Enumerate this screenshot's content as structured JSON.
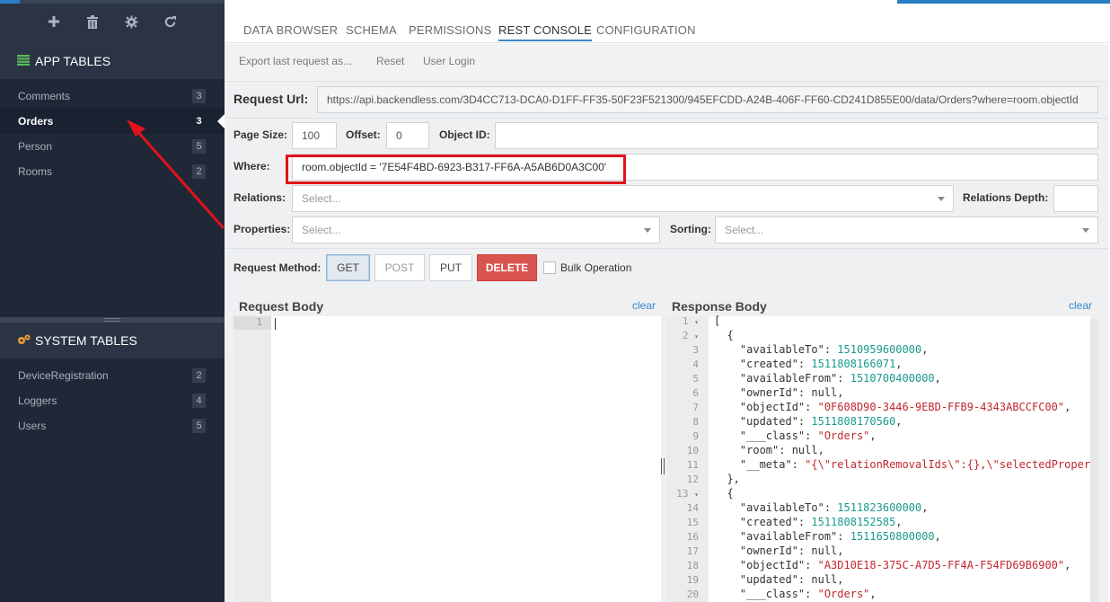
{
  "sidebar": {
    "app_tables_title": "APP TABLES",
    "app_tables": [
      {
        "name": "Comments",
        "count": "3",
        "active": false
      },
      {
        "name": "Orders",
        "count": "3",
        "active": true
      },
      {
        "name": "Person",
        "count": "5",
        "active": false
      },
      {
        "name": "Rooms",
        "count": "2",
        "active": false
      }
    ],
    "system_tables_title": "SYSTEM TABLES",
    "system_tables": [
      {
        "name": "DeviceRegistration",
        "count": "2"
      },
      {
        "name": "Loggers",
        "count": "4"
      },
      {
        "name": "Users",
        "count": "5"
      }
    ],
    "toolbar_icons": [
      "plus-icon",
      "trash-icon",
      "gear-icon",
      "refresh-icon"
    ]
  },
  "tabs": [
    "DATA BROWSER",
    "SCHEMA",
    "PERMISSIONS",
    "REST CONSOLE",
    "CONFIGURATION"
  ],
  "active_tab": "REST CONSOLE",
  "subbar": {
    "export": "Export last request as...",
    "reset": "Reset",
    "user_login": "User Login"
  },
  "form": {
    "request_url_label": "Request Url:",
    "request_url": "https://api.backendless.com/3D4CC713-DCA0-D1FF-FF35-50F23F521300/945EFCDD-A24B-406F-FF60-CD241D855E00/data/Orders?where=room.objectId",
    "page_size_label": "Page Size:",
    "page_size": "100",
    "offset_label": "Offset:",
    "offset": "0",
    "object_id_label": "Object ID:",
    "object_id": "",
    "where_label": "Where:",
    "where": "room.objectId = '7E54F4BD-6923-B317-FF6A-A5AB6D0A3C00'",
    "relations_label": "Relations:",
    "relations_placeholder": "Select...",
    "relations_depth_label": "Relations Depth:",
    "relations_depth": "",
    "properties_label": "Properties:",
    "properties_placeholder": "Select...",
    "sorting_label": "Sorting:",
    "sorting_placeholder": "Select...",
    "request_method_label": "Request Method:",
    "methods": {
      "get": "GET",
      "post": "POST",
      "put": "PUT",
      "delete": "DELETE"
    },
    "selected_method": "GET",
    "bulk_operation_label": "Bulk Operation",
    "bulk_operation_checked": false
  },
  "request_body": {
    "title": "Request Body",
    "clear": "clear",
    "line_numbers": [
      "1"
    ]
  },
  "response_body": {
    "title": "Response Body",
    "clear": "clear",
    "lines": [
      {
        "n": "1",
        "fold": true,
        "text": "["
      },
      {
        "n": "2",
        "fold": true,
        "text": "  {"
      },
      {
        "n": "3",
        "key": "\"availableTo\"",
        "num": "1510959600000"
      },
      {
        "n": "4",
        "key": "\"created\"",
        "num": "1511808166071"
      },
      {
        "n": "5",
        "key": "\"availableFrom\"",
        "num": "1510700400000"
      },
      {
        "n": "6",
        "key": "\"ownerId\"",
        "lit": "null"
      },
      {
        "n": "7",
        "key": "\"objectId\"",
        "str": "\"0F608D90-3446-9EBD-FFB9-4343ABCCFC00\""
      },
      {
        "n": "8",
        "key": "\"updated\"",
        "num": "1511808170560"
      },
      {
        "n": "9",
        "key": "\"___class\"",
        "str": "\"Orders\""
      },
      {
        "n": "10",
        "key": "\"room\"",
        "lit": "null"
      },
      {
        "n": "11",
        "key": "\"__meta\"",
        "str": "\"{\\\"relationRemovalIds\\\":{},\\\"selectedPropert"
      },
      {
        "n": "12",
        "text": "  },"
      },
      {
        "n": "13",
        "fold": true,
        "text": "  {"
      },
      {
        "n": "14",
        "key": "\"availableTo\"",
        "num": "1511823600000"
      },
      {
        "n": "15",
        "key": "\"created\"",
        "num": "1511808152585"
      },
      {
        "n": "16",
        "key": "\"availableFrom\"",
        "num": "1511650800000"
      },
      {
        "n": "17",
        "key": "\"ownerId\"",
        "lit": "null"
      },
      {
        "n": "18",
        "key": "\"objectId\"",
        "str": "\"A3D10E18-375C-A7D5-FF4A-F54FD69B6900\""
      },
      {
        "n": "19",
        "key": "\"updated\"",
        "lit": "null"
      },
      {
        "n": "20",
        "key": "\"___class\"",
        "str": "\"Orders\""
      }
    ]
  },
  "colors": {
    "sidebar_bg": "#202838",
    "accent_blue": "#2a7fc4",
    "delete_red": "#d9534f",
    "highlight_red": "#e0131a",
    "json_number": "#1a9a8c",
    "json_string": "#c1272d"
  }
}
